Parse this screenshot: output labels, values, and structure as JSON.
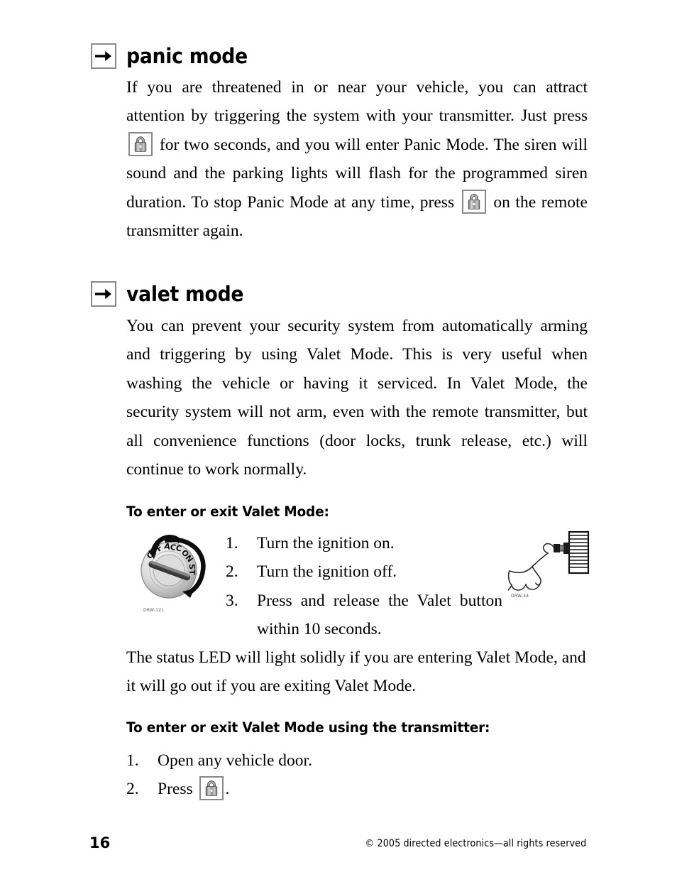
{
  "document": {
    "page_number": "16",
    "copyright": "© 2005 directed electronics—all rights reserved"
  },
  "sections": [
    {
      "id": "panic-mode",
      "arrow_icon": "arrow-right-icon",
      "title": "panic mode",
      "paragraph_part1": "If you are threatened in or near your vehicle, you can attract attention by triggering the system with your transmitter. Just press ",
      "lock_icon": "lock-icon",
      "paragraph_part2": " for two seconds, and you will enter Panic Mode. The siren will sound and the parking lights will flash for the programmed siren duration. To stop Panic Mode at any time, press ",
      "paragraph_part3": " on the remote transmitter again."
    },
    {
      "id": "valet-mode",
      "arrow_icon": "arrow-right-icon",
      "title": "valet mode",
      "paragraph": "You can prevent your security system from automatically arming and triggering by using Valet Mode. This is very useful when washing the vehicle or having it serviced. In Valet Mode, the security system will not arm, even with the remote transmitter, but all convenience functions (door locks, trunk release, etc.) will continue to work normally."
    }
  ],
  "enter_exit_valet": {
    "subhead": "To enter or exit Valet Mode:",
    "steps": [
      {
        "marker": "1.",
        "text": "Turn the ignition on."
      },
      {
        "marker": "2.",
        "text": "Turn the ignition off."
      },
      {
        "marker": "3.",
        "text": "Press and release the Valet button within 10 seconds."
      }
    ],
    "status_led_note": "The status LED will light solidly if you are entering Valet Mode, and it will go out if you are exiting Valet Mode."
  },
  "enter_exit_transmitter": {
    "subhead": "To enter or exit Valet Mode using the transmitter:",
    "steps": [
      {
        "marker": "1.",
        "text": "Open any vehicle door."
      },
      {
        "marker": "2.",
        "text_before": "Press ",
        "lock_icon": "lock-icon",
        "text_after": "."
      }
    ]
  },
  "figures": {
    "ignition_switch": {
      "name": "ignition-switch-illustration",
      "caption": "DRW-121",
      "positions": [
        "OFF",
        "ACC",
        "ON",
        "ST"
      ]
    },
    "valet_button": {
      "name": "valet-button-illustration",
      "caption": "DRW-44"
    }
  },
  "colors": {
    "text": "#000000",
    "icon_border": "#8a8a8a",
    "dial_light": "#e8e8e8",
    "dial_dark": "#9b9b9b",
    "caption": "#555555"
  }
}
